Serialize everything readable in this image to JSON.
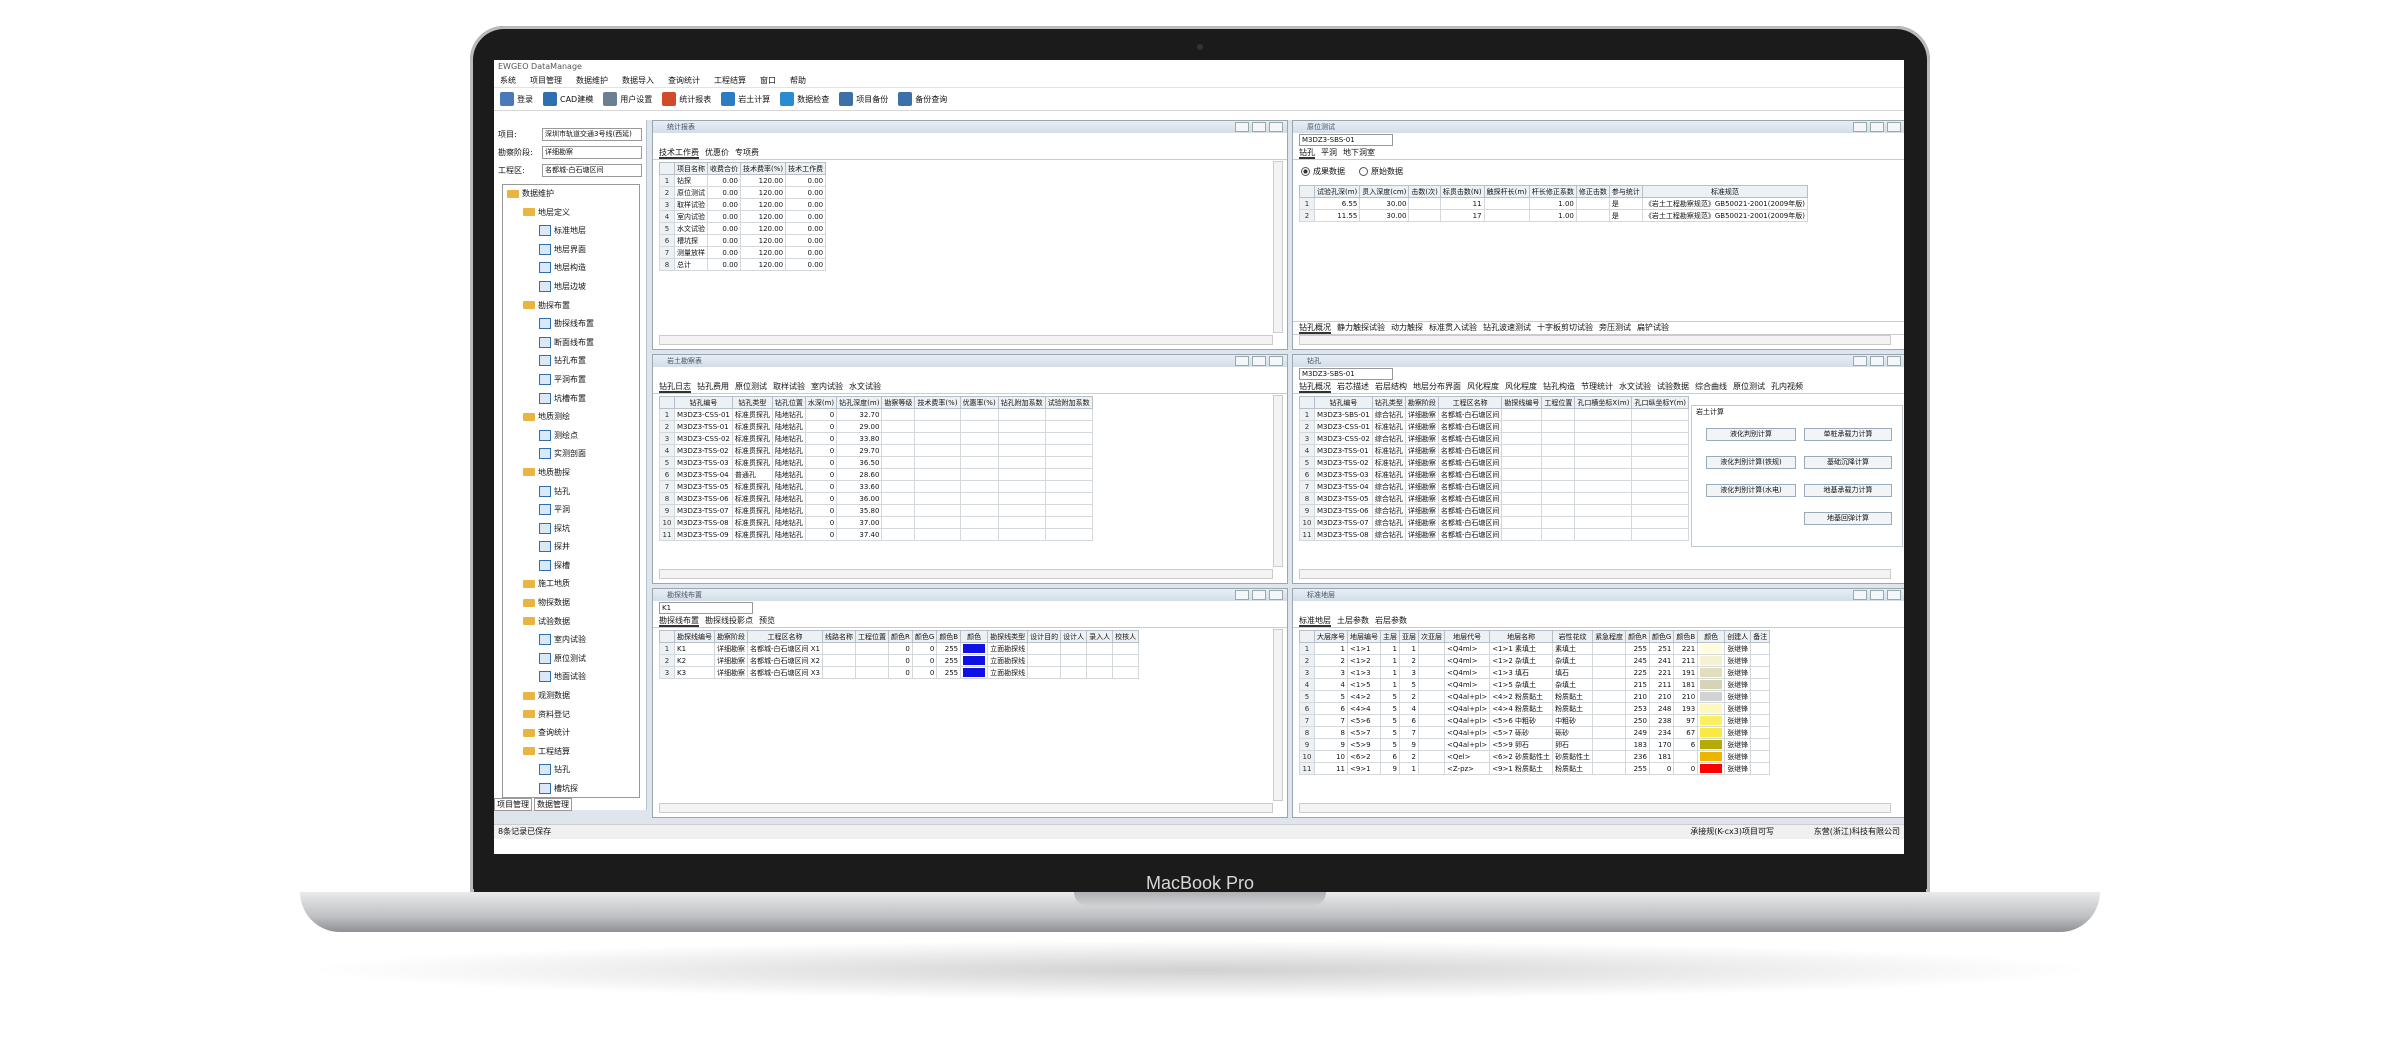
{
  "device_label": "MacBook Pro",
  "app_title": "EWGEO DataManage",
  "menu": [
    "系统",
    "项目管理",
    "数据维护",
    "数据导入",
    "查询统计",
    "工程结算",
    "窗口",
    "帮助"
  ],
  "toolbar": [
    {
      "label": "登录",
      "icon": "user-icon",
      "color": "#4a78b8"
    },
    {
      "label": "CAD建模",
      "icon": "cad-icon",
      "color": "#2f6fb0"
    },
    {
      "label": "用户设置",
      "icon": "tools-icon",
      "color": "#6b7f93"
    },
    {
      "label": "统计报表",
      "icon": "report-icon",
      "color": "#d04b2a"
    },
    {
      "label": "岩土计算",
      "icon": "calc-icon",
      "color": "#2d7bc4"
    },
    {
      "label": "数据检查",
      "icon": "search-icon",
      "color": "#2a8bd0"
    },
    {
      "label": "项目备份",
      "icon": "backup-icon",
      "color": "#3d6fa8"
    },
    {
      "label": "备份查询",
      "icon": "list-icon",
      "color": "#3d6fa8"
    }
  ],
  "left": {
    "fields": [
      {
        "key": "项目:",
        "value": "深圳市轨道交通3号线(西延)"
      },
      {
        "key": "勘察阶段:",
        "value": "详细勘察"
      },
      {
        "key": "工程区:",
        "value": "名都城-白石塘区间"
      }
    ],
    "tree": [
      {
        "label": "数据维护",
        "level": 0,
        "type": "root"
      },
      {
        "label": "地层定义",
        "level": 1,
        "type": "folder"
      },
      {
        "label": "标准地层",
        "level": 2,
        "type": "doc"
      },
      {
        "label": "地层界面",
        "level": 2,
        "type": "doc"
      },
      {
        "label": "地层构造",
        "level": 2,
        "type": "doc"
      },
      {
        "label": "地层边坡",
        "level": 2,
        "type": "doc"
      },
      {
        "label": "勘探布置",
        "level": 1,
        "type": "folder"
      },
      {
        "label": "勘探线布置",
        "level": 2,
        "type": "doc"
      },
      {
        "label": "断面线布置",
        "level": 2,
        "type": "doc"
      },
      {
        "label": "钻孔布置",
        "level": 2,
        "type": "doc"
      },
      {
        "label": "平洞布置",
        "level": 2,
        "type": "doc"
      },
      {
        "label": "坑槽布置",
        "level": 2,
        "type": "doc"
      },
      {
        "label": "地质测绘",
        "level": 1,
        "type": "folder"
      },
      {
        "label": "测绘点",
        "level": 2,
        "type": "doc"
      },
      {
        "label": "实测剖面",
        "level": 2,
        "type": "doc"
      },
      {
        "label": "地质勘探",
        "level": 1,
        "type": "folder"
      },
      {
        "label": "钻孔",
        "level": 2,
        "type": "doc"
      },
      {
        "label": "平洞",
        "level": 2,
        "type": "doc"
      },
      {
        "label": "探坑",
        "level": 2,
        "type": "doc"
      },
      {
        "label": "探井",
        "level": 2,
        "type": "doc"
      },
      {
        "label": "探槽",
        "level": 2,
        "type": "doc"
      },
      {
        "label": "施工地质",
        "level": 1,
        "type": "folder"
      },
      {
        "label": "物探数据",
        "level": 1,
        "type": "folder"
      },
      {
        "label": "试验数据",
        "level": 1,
        "type": "folder"
      },
      {
        "label": "室内试验",
        "level": 2,
        "type": "doc"
      },
      {
        "label": "原位测试",
        "level": 2,
        "type": "doc"
      },
      {
        "label": "地面试验",
        "level": 2,
        "type": "doc"
      },
      {
        "label": "观测数据",
        "level": 1,
        "type": "folder"
      },
      {
        "label": "资料登记",
        "level": 1,
        "type": "folder"
      },
      {
        "label": "查询统计",
        "level": 1,
        "type": "folder"
      },
      {
        "label": "工程结算",
        "level": 1,
        "type": "folder"
      },
      {
        "label": "钻孔",
        "level": 2,
        "type": "doc"
      },
      {
        "label": "槽坑探",
        "level": 2,
        "type": "doc"
      },
      {
        "label": "测量放样",
        "level": 2,
        "type": "doc"
      }
    ],
    "tabs": [
      "项目管理",
      "数据管理"
    ]
  },
  "panel1": {
    "title": "统计报表",
    "tabs": [
      "技术工作费",
      "优惠价",
      "专项费"
    ],
    "columns": [
      "项目名称",
      "收费合价",
      "技术费率(%)",
      "技术工作费"
    ],
    "rows": [
      [
        "钻探",
        "0.00",
        "120.00",
        "0.00"
      ],
      [
        "原位测试",
        "0.00",
        "120.00",
        "0.00"
      ],
      [
        "取样试验",
        "0.00",
        "120.00",
        "0.00"
      ],
      [
        "室内试验",
        "0.00",
        "120.00",
        "0.00"
      ],
      [
        "水文试验",
        "0.00",
        "120.00",
        "0.00"
      ],
      [
        "槽坑探",
        "0.00",
        "120.00",
        "0.00"
      ],
      [
        "测量放样",
        "0.00",
        "120.00",
        "0.00"
      ],
      [
        "总计",
        "0.00",
        "120.00",
        "0.00"
      ]
    ]
  },
  "panel2": {
    "title": "原位测试",
    "combo": "M3DZ3-SBS-01",
    "tabs": [
      "钻孔",
      "平洞",
      "地下洞室"
    ],
    "radios": [
      "成果数据",
      "原始数据"
    ],
    "columns": [
      "试验孔深(m)",
      "贯入深度(cm)",
      "击数(次)",
      "标贯击数(N)",
      "触探杆长(m)",
      "杆长修正系数",
      "修正击数",
      "参与统计",
      "标准规范"
    ],
    "rows": [
      [
        "6.55",
        "30.00",
        "",
        "11",
        "",
        "1.00",
        "",
        "是",
        "《岩土工程勘察规范》GB50021-2001(2009年版)"
      ],
      [
        "11.55",
        "30.00",
        "",
        "17",
        "",
        "1.00",
        "",
        "是",
        "《岩土工程勘察规范》GB50021-2001(2009年版)"
      ]
    ],
    "bottom_tabs": [
      "钻孔概况",
      "静力触探试验",
      "动力触探",
      "标准贯入试验",
      "钻孔波速测试",
      "十字板剪切试验",
      "旁压测试",
      "扁铲试验"
    ]
  },
  "panel3": {
    "title": "岩土勘察表",
    "tabs": [
      "钻孔日志",
      "钻孔费用",
      "原位测试",
      "取样试验",
      "室内试验",
      "水文试验"
    ],
    "columns": [
      "钻孔编号",
      "钻孔类型",
      "钻孔位置",
      "水深(m)",
      "钻孔深度(m)",
      "勘察等级",
      "技术费率(%)",
      "优惠率(%)",
      "钻孔附加系数",
      "试验附加系数"
    ],
    "rows": [
      [
        "M3DZ3-CSS-01",
        "标准贯探孔",
        "陆地钻孔",
        "0",
        "32.70"
      ],
      [
        "M3DZ3-TSS-01",
        "标准贯探孔",
        "陆地钻孔",
        "0",
        "29.00"
      ],
      [
        "M3DZ3-CSS-02",
        "标准贯探孔",
        "陆地钻孔",
        "0",
        "33.80"
      ],
      [
        "M3DZ3-TSS-02",
        "标准贯探孔",
        "陆地钻孔",
        "0",
        "29.70"
      ],
      [
        "M3DZ3-TSS-03",
        "标准贯探孔",
        "陆地钻孔",
        "0",
        "36.50"
      ],
      [
        "M3DZ3-TSS-04",
        "普通孔",
        "陆地钻孔",
        "0",
        "28.60"
      ],
      [
        "M3DZ3-TSS-05",
        "标准贯探孔",
        "陆地钻孔",
        "0",
        "33.60"
      ],
      [
        "M3DZ3-TSS-06",
        "标准贯探孔",
        "陆地钻孔",
        "0",
        "36.00"
      ],
      [
        "M3DZ3-TSS-07",
        "标准贯探孔",
        "陆地钻孔",
        "0",
        "35.80"
      ],
      [
        "M3DZ3-TSS-08",
        "标准贯探孔",
        "陆地钻孔",
        "0",
        "37.00"
      ],
      [
        "M3DZ3-TSS-09",
        "标准贯探孔",
        "陆地钻孔",
        "0",
        "37.40"
      ]
    ]
  },
  "panel4": {
    "title": "钻孔",
    "combo": "M3DZ3-SBS-01",
    "tabs": [
      "钻孔概况",
      "岩芯描述",
      "岩层结构",
      "地层分布界面",
      "风化程度",
      "风化程度",
      "钻孔构造",
      "节理统计",
      "水文试验",
      "试验数据",
      "综合曲线",
      "原位测试",
      "孔内视频"
    ],
    "columns": [
      "钻孔编号",
      "钻孔类型",
      "勘察阶段",
      "工程区名称",
      "勘探线编号",
      "工程位置",
      "孔口横坐标X(m)",
      "孔口纵坐标Y(m)"
    ],
    "rows": [
      [
        "M3DZ3-SBS-01",
        "综合钻孔",
        "详细勘察",
        "名都城-白石塘区间"
      ],
      [
        "M3DZ3-CSS-01",
        "标准钻孔",
        "详细勘察",
        "名都城-白石塘区间"
      ],
      [
        "M3DZ3-CSS-02",
        "综合钻孔",
        "详细勘察",
        "名都城-白石塘区间"
      ],
      [
        "M3DZ3-TSS-01",
        "标准钻孔",
        "详细勘察",
        "名都城-白石塘区间"
      ],
      [
        "M3DZ3-TSS-02",
        "标准钻孔",
        "详细勘察",
        "名都城-白石塘区间"
      ],
      [
        "M3DZ3-TSS-03",
        "标准钻孔",
        "详细勘察",
        "名都城-白石塘区间"
      ],
      [
        "M3DZ3-TSS-04",
        "综合钻孔",
        "详细勘察",
        "名都城-白石塘区间"
      ],
      [
        "M3DZ3-TSS-05",
        "综合钻孔",
        "详细勘察",
        "名都城-白石塘区间"
      ],
      [
        "M3DZ3-TSS-06",
        "综合钻孔",
        "详细勘察",
        "名都城-白石塘区间"
      ],
      [
        "M3DZ3-TSS-07",
        "综合钻孔",
        "详细勘察",
        "名都城-白石塘区间"
      ],
      [
        "M3DZ3-TSS-08",
        "综合钻孔",
        "详细勘察",
        "名都城-白石塘区间"
      ]
    ],
    "popup": {
      "title": "岩土计算",
      "buttons": [
        "液化判别计算",
        "单桩承载力计算",
        "液化判别计算(铁规)",
        "基础沉降计算",
        "液化判别计算(水电)",
        "地基承载力计算",
        "地基回弹计算"
      ]
    }
  },
  "panel5": {
    "title": "勘探线布置",
    "combo": "K1",
    "tabs": [
      "勘探线布置",
      "勘探线投影点",
      "预览"
    ],
    "columns": [
      "勘探线编号",
      "勘察阶段",
      "工程区名称",
      "线路名称",
      "工程位置",
      "颜色R",
      "颜色G",
      "颜色B",
      "颜色",
      "勘探线类型",
      "设计目的",
      "设计人",
      "录入人",
      "校核人"
    ],
    "rows": [
      [
        "K1",
        "详细勘察",
        "名都城-白石塘区间 X1",
        "0",
        "0",
        "255",
        "",
        "立面勘探线"
      ],
      [
        "K2",
        "详细勘察",
        "名都城-白石塘区间 X2",
        "0",
        "0",
        "255",
        "",
        "立面勘探线"
      ],
      [
        "K3",
        "详细勘察",
        "名都城-白石塘区间 X3",
        "0",
        "0",
        "255",
        "",
        "立面勘探线"
      ]
    ],
    "swatch_color": "#1010e6"
  },
  "panel6": {
    "title": "标准地层",
    "tabs": [
      "标准地层",
      "土层参数",
      "岩层参数"
    ],
    "columns": [
      "大层序号",
      "地层编号",
      "主层",
      "亚层",
      "次亚层",
      "地层代号",
      "地层名称",
      "岩性花纹",
      "紧急程度",
      "颜色R",
      "颜色G",
      "颜色B",
      "颜色",
      "创建人",
      "备注"
    ],
    "rows": [
      [
        "1",
        "<1>1",
        "1",
        "1",
        "",
        "<Q4ml>",
        "<1>1 素填土",
        "素填土",
        "",
        "255",
        "251",
        "221",
        "#fffbdd",
        "张继锋"
      ],
      [
        "2",
        "<1>2",
        "1",
        "2",
        "",
        "<Q4ml>",
        "<1>2 杂填土",
        "杂填土",
        "",
        "245",
        "241",
        "211",
        "#f5f1d3",
        "张继锋"
      ],
      [
        "3",
        "<1>3",
        "1",
        "3",
        "",
        "<Q4ml>",
        "<1>3 填石",
        "填石",
        "",
        "225",
        "221",
        "191",
        "#e1ddbf",
        "张继锋"
      ],
      [
        "4",
        "<1>5",
        "1",
        "5",
        "",
        "<Q4ml>",
        "<1>5 杂填土",
        "杂填土",
        "",
        "215",
        "211",
        "181",
        "#d7d3b5",
        "张继锋"
      ],
      [
        "5",
        "<4>2",
        "5",
        "2",
        "",
        "<Q4al+pl>",
        "<4>2 粉质黏土",
        "粉质黏土",
        "",
        "210",
        "210",
        "210",
        "#d2d2d2",
        "张继锋"
      ],
      [
        "6",
        "<4>4",
        "5",
        "4",
        "",
        "<Q4al+pl>",
        "<4>4 粉质黏土",
        "粉质黏土",
        "",
        "253",
        "248",
        "193",
        "#fdf8c1",
        "张继锋"
      ],
      [
        "7",
        "<5>6",
        "5",
        "6",
        "",
        "<Q4al+pl>",
        "<5>6 中粗砂",
        "中粗砂",
        "",
        "250",
        "238",
        "97",
        "#faee61",
        "张继锋"
      ],
      [
        "8",
        "<5>7",
        "5",
        "7",
        "",
        "<Q4al+pl>",
        "<5>7 砾砂",
        "砾砂",
        "",
        "249",
        "234",
        "67",
        "#f9ea43",
        "张继锋"
      ],
      [
        "9",
        "<5>9",
        "5",
        "9",
        "",
        "<Q4al+pl>",
        "<5>9 卵石",
        "卵石",
        "",
        "183",
        "170",
        "6",
        "#b7aa06",
        "张继锋"
      ],
      [
        "10",
        "<6>2",
        "6",
        "2",
        "",
        "<Qel>",
        "<6>2 砂质黏性土",
        "砂质黏性土",
        "",
        "236",
        "181",
        "",
        "#ecb500",
        "张继锋"
      ],
      [
        "11",
        "<9>1",
        "9",
        "1",
        "",
        "<Z-pz>",
        "<9>1 粉质黏土",
        "粉质黏土",
        "",
        "255",
        "0",
        "0",
        "#ff0000",
        "张继锋"
      ]
    ]
  },
  "status": {
    "left": "8条记录已保存",
    "right_1": "承接规(K-cx3)项目可写",
    "right_2": "东营(浙江)科技有限公司"
  }
}
